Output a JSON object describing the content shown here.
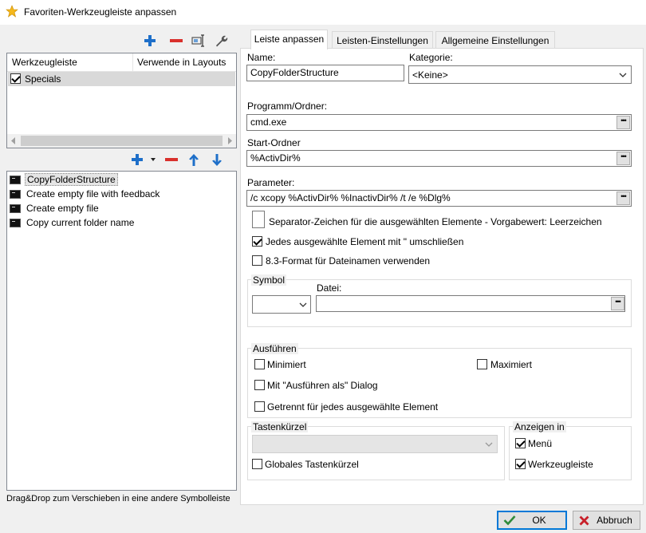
{
  "window": {
    "title": "Favoriten-Werkzeugleiste anpassen"
  },
  "left": {
    "toolbars_table": {
      "headers": [
        "Werkzeugleiste",
        "Verwende in Layouts"
      ],
      "rows": [
        {
          "name": "Specials",
          "checked": true
        }
      ]
    },
    "commands": [
      {
        "label": "CopyFolderStructure",
        "selected": true
      },
      {
        "label": "Create empty file with feedback",
        "selected": false
      },
      {
        "label": "Create empty file",
        "selected": false
      },
      {
        "label": "Copy current folder name",
        "selected": false
      }
    ],
    "hint": "Drag&Drop zum Verschieben in eine andere Symbolleiste"
  },
  "tabs": [
    {
      "label": "Leiste anpassen",
      "active": true
    },
    {
      "label": "Leisten-Einstellungen",
      "active": false
    },
    {
      "label": "Allgemeine Einstellungen",
      "active": false
    }
  ],
  "form": {
    "name_label": "Name:",
    "name_value": "CopyFolderStructure",
    "category_label": "Kategorie:",
    "category_value": "<Keine>",
    "program_label": "Programm/Ordner:",
    "program_value": "cmd.exe",
    "start_label": "Start-Ordner",
    "start_value": "%ActivDir%",
    "param_label": "Parameter:",
    "param_value": "/c xcopy %ActivDir% %InactivDir% /t /e %Dlg%",
    "separator_label": "Separator-Zeichen für die ausgewählten Elemente - Vorgabewert: Leerzeichen",
    "quote_label": "Jedes ausgewählte Element mit \" umschließen",
    "quote_checked": true,
    "short83_label": "8.3-Format für Dateinamen verwenden",
    "short83_checked": false,
    "symbol_group": "Symbol",
    "file_label": "Datei:",
    "file_value": "",
    "run_group": "Ausführen",
    "minimized_label": "Minimiert",
    "maximized_label": "Maximiert",
    "runas_label": "Mit \"Ausführen als\" Dialog",
    "separate_label": "Getrennt für jedes ausgewählte Element",
    "shortcut_group": "Tastenkürzel",
    "global_shortcut_label": "Globales Tastenkürzel",
    "show_group": "Anzeigen in",
    "show_menu_label": "Menü",
    "show_menu_checked": true,
    "show_toolbar_label": "Werkzeugleiste",
    "show_toolbar_checked": true
  },
  "buttons": {
    "ok": "OK",
    "cancel": "Abbruch"
  },
  "colors": {
    "accent": "#0078d7",
    "add": "#1e6fc9",
    "remove": "#d9302c",
    "ok_check": "#2e8b3a",
    "cancel_x": "#c8202a"
  }
}
